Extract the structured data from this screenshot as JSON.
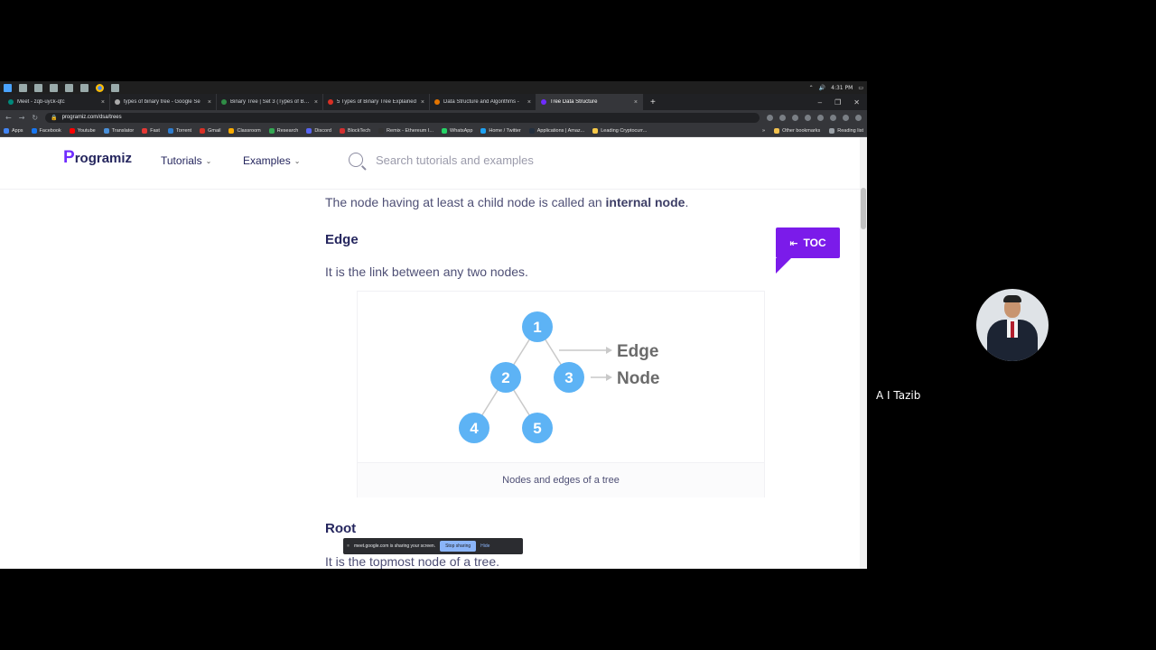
{
  "taskbar": {
    "time": "4:31 PM"
  },
  "tabs": [
    {
      "label": "Meet - zqb-uyck-qtc",
      "fav_color": "#00897b"
    },
    {
      "label": "types of binary tree - Google Se",
      "fav_color": "#aaaaaa"
    },
    {
      "label": "Binary Tree | Set 3 (Types of Bina",
      "fav_color": "#2f8d46"
    },
    {
      "label": "5 Types of Binary Tree Explained",
      "fav_color": "#d93025"
    },
    {
      "label": "Data Structure and Algorithms -",
      "fav_color": "#e37400"
    },
    {
      "label": "Tree Data Structure",
      "fav_color": "#6f2cff"
    }
  ],
  "address": {
    "url": "programiz.com/dsa/trees"
  },
  "bookmarks": [
    {
      "label": "Apps",
      "color": "#4285f4"
    },
    {
      "label": "Facebook",
      "color": "#1877f2"
    },
    {
      "label": "Youtube",
      "color": "#ff0000"
    },
    {
      "label": "Translator",
      "color": "#4a90d9"
    },
    {
      "label": "Fast",
      "color": "#e53935"
    },
    {
      "label": "Torrent",
      "color": "#2e7dcf"
    },
    {
      "label": "Gmail",
      "color": "#d93025"
    },
    {
      "label": "Classroom",
      "color": "#f9ab00"
    },
    {
      "label": "Research",
      "color": "#34a853"
    },
    {
      "label": "Discord",
      "color": "#5865f2"
    },
    {
      "label": "BlockTech",
      "color": "#d32f2f"
    },
    {
      "label": "Remix - Ethereum I...",
      "color": "#333333"
    },
    {
      "label": "WhatsApp",
      "color": "#25d366"
    },
    {
      "label": "Home / Twitter",
      "color": "#1da1f2"
    },
    {
      "label": "Applications | Amaz...",
      "color": "#232f3e"
    },
    {
      "label": "Leading Cryptocurr...",
      "color": "#f7c948"
    }
  ],
  "bookmarks_right": {
    "more": "»",
    "other": "Other bookmarks",
    "reading": "Reading list"
  },
  "site": {
    "logo_p": "P",
    "logo_rest": "rogramiz",
    "tutorials": "Tutorials",
    "examples": "Examples",
    "search_placeholder": "Search tutorials and examples"
  },
  "article": {
    "internal_text": "The node having at least a child node is called an ",
    "internal_bold": "internal node",
    "internal_end": ".",
    "edge_heading": "Edge",
    "edge_text": "It is the link between any two nodes.",
    "caption": "Nodes and edges of a tree",
    "root_heading": "Root",
    "root_text": "It is the topmost node of a tree."
  },
  "diagram": {
    "nodes": [
      "1",
      "2",
      "3",
      "4",
      "5"
    ],
    "edge_label": "Edge",
    "node_label": "Node",
    "node_color": "#5db3f5",
    "line_color": "#c9c9c9"
  },
  "toc": {
    "label": "TOC",
    "color": "#7b1bea"
  },
  "share_bar": {
    "message": "meet.google.com is sharing your screen.",
    "stop": "Stop sharing",
    "hide": "Hide"
  },
  "participant": {
    "name": "A I Tazib"
  }
}
